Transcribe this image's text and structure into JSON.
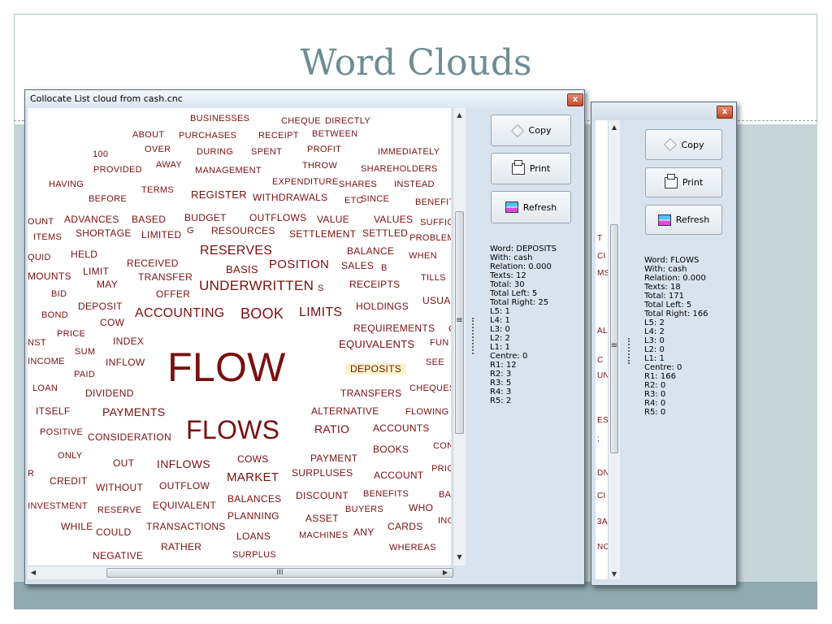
{
  "slide": {
    "title": "Word Clouds"
  },
  "window_main": {
    "title": "Collocate List cloud from cash.cnc",
    "close_glyph": "x",
    "buttons": {
      "copy": "Copy",
      "print": "Print",
      "refresh": "Refresh"
    },
    "stats": [
      "Word: DEPOSITS",
      "With: cash",
      "Relation: 0.000",
      "Texts: 12",
      "Total: 30",
      "Total Left: 5",
      "Total Right: 25",
      "L5: 1",
      "L4: 1",
      "L3: 0",
      "L2: 2",
      "L1: 1",
      "Centre: 0",
      "R1: 12",
      "R2: 3",
      "R3: 5",
      "R4: 3",
      "R5: 2"
    ],
    "scroll_glyphs": {
      "up": "▲",
      "down": "▼",
      "left": "◀",
      "right": "▶",
      "grip": "≡",
      "hgrip": "III"
    },
    "words": [
      "BUSINESSES",
      "CHEQUE",
      "DIRECTLY",
      "ABOUT",
      "PURCHASES",
      "RECEIPT",
      "BETWEEN",
      "100",
      "OVER",
      "DURING",
      "SPENT",
      "PROFIT",
      "IMMEDIATELY",
      "PROVIDED",
      "AWAY",
      "MANAGEMENT",
      "THROW",
      "SHAREHOLDERS",
      "HAVING",
      "TERMS",
      "EXPENDITURE",
      "SHARES",
      "INSTEAD",
      "BEFORE",
      "REGISTER",
      "WITHDRAWALS",
      "ETC",
      "SINCE",
      "BENEFIT",
      "OUNT",
      "ADVANCES",
      "BASED",
      "BUDGET",
      "OUTFLOWS",
      "VALUE",
      "VALUES",
      "SUFFICI",
      "ITEMS",
      "SHORTAGE",
      "LIMITED",
      "G",
      "RESOURCES",
      "SETTLEMENT",
      "SETTLED",
      "PROBLEMS",
      "QUID",
      "HELD",
      "RESERVES",
      "BALANCE",
      "WHEN",
      "LIMIT",
      "RECEIVED",
      "BASIS",
      "POSITION",
      "SALES",
      "B",
      "MOUNTS",
      "TRANSFER",
      "TILLS",
      "MAY",
      "UNDERWRITTEN",
      "S",
      "RECEIPTS",
      "BID",
      "OFFER",
      "USUAL",
      "DEPOSIT",
      "HOLDINGS",
      "BOND",
      "COW",
      "ACCOUNTING",
      "BOOK",
      "LIMITS",
      "PRICE",
      "REQUIREMENTS",
      "C",
      "NST",
      "INDEX",
      "SUM",
      "EQUIVALENTS",
      "FUN",
      "INCOME",
      "INFLOW",
      "FLOW",
      "SEE",
      "DEPOSITS",
      "PAID",
      "LOAN",
      "DIVIDEND",
      "TRANSFERS",
      "CHEQUES",
      "ITSELF",
      "PAYMENTS",
      "ALTERNATIVE",
      "FLOWING",
      "FLOWS",
      "RATIO",
      "ACCOUNTS",
      "POSITIVE",
      "CONSIDERATION",
      "CON",
      "ONLY",
      "OUT",
      "INFLOWS",
      "COWS",
      "PAYMENT",
      "BOOKS",
      "MARKET",
      "SURPLUSES",
      "ACCOUNT",
      "PRICI",
      "R",
      "CREDIT",
      "WITHOUT",
      "OUTFLOW",
      "DISCOUNT",
      "BENEFITS",
      "BA",
      "BALANCES",
      "EQUIVALENT",
      "INVESTMENT",
      "RESERVE",
      "BUYERS",
      "WHO",
      "PLANNING",
      "ASSET",
      "INC",
      "WHILE",
      "TRANSACTIONS",
      "CARDS",
      "COULD",
      "LOANS",
      "MACHINES",
      "ANY",
      "RATHER",
      "WHEREAS",
      "NEGATIVE",
      "SURPLUS"
    ]
  },
  "window_back": {
    "close_glyph": "x",
    "buttons": {
      "copy": "Copy",
      "print": "Print",
      "refresh": "Refresh"
    },
    "stats": [
      "Word: FLOWS",
      "With: cash",
      "Relation: 0.000",
      "Texts: 18",
      "Total: 171",
      "Total Left: 5",
      "Total Right: 166",
      "L5: 2",
      "L4: 2",
      "L3: 0",
      "L2: 0",
      "L1: 1",
      "Centre: 0",
      "R1: 166",
      "R2: 0",
      "R3: 0",
      "R4: 0",
      "R5: 0"
    ],
    "edge_words": [
      "T",
      "CI",
      "MS",
      "AL",
      "C",
      "UN",
      "ES",
      ";",
      "DN",
      "CI",
      "3A",
      "NC"
    ],
    "scroll_glyphs": {
      "up": "▲",
      "down": "▼",
      "grip": "≡",
      "right": "▶"
    }
  },
  "colors": {
    "cloud_word": "#7a1010",
    "highlight_bg": "#fbf6c9",
    "title": "#6e8d92"
  }
}
